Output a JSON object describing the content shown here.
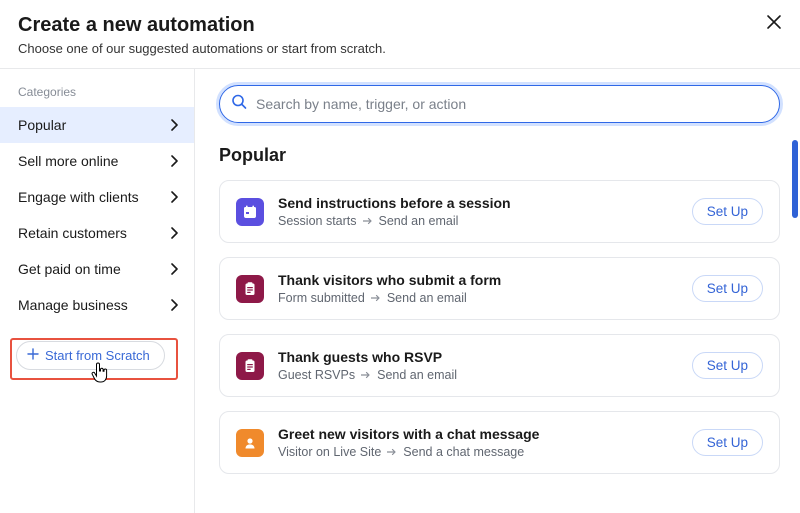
{
  "header": {
    "title": "Create a new automation",
    "subtitle": "Choose one of our suggested automations or start from scratch."
  },
  "sidebar": {
    "heading": "Categories",
    "items": [
      {
        "label": "Popular",
        "active": true
      },
      {
        "label": "Sell more online",
        "active": false
      },
      {
        "label": "Engage with clients",
        "active": false
      },
      {
        "label": "Retain customers",
        "active": false
      },
      {
        "label": "Get paid on time",
        "active": false
      },
      {
        "label": "Manage business",
        "active": false
      }
    ],
    "scratch": "Start from Scratch"
  },
  "search": {
    "placeholder": "Search by name, trigger, or action"
  },
  "section": {
    "title": "Popular"
  },
  "cards": [
    {
      "id": "session-instructions",
      "icon": "calendar-icon",
      "icon_bg": "bg-purple",
      "title": "Send instructions before a session",
      "trigger": "Session starts",
      "action": "Send an email",
      "button": "Set Up"
    },
    {
      "id": "thank-form",
      "icon": "clipboard-icon",
      "icon_bg": "bg-magenta",
      "title": "Thank visitors who submit a form",
      "trigger": "Form submitted",
      "action": "Send an email",
      "button": "Set Up"
    },
    {
      "id": "thank-rsvp",
      "icon": "clipboard-icon",
      "icon_bg": "bg-magenta",
      "title": "Thank guests who RSVP",
      "trigger": "Guest RSVPs",
      "action": "Send an email",
      "button": "Set Up"
    },
    {
      "id": "greet-chat",
      "icon": "chat-avatar-icon",
      "icon_bg": "bg-orange",
      "title": "Greet new visitors with a chat message",
      "trigger": "Visitor on Live Site",
      "action": "Send a chat message",
      "button": "Set Up"
    }
  ]
}
